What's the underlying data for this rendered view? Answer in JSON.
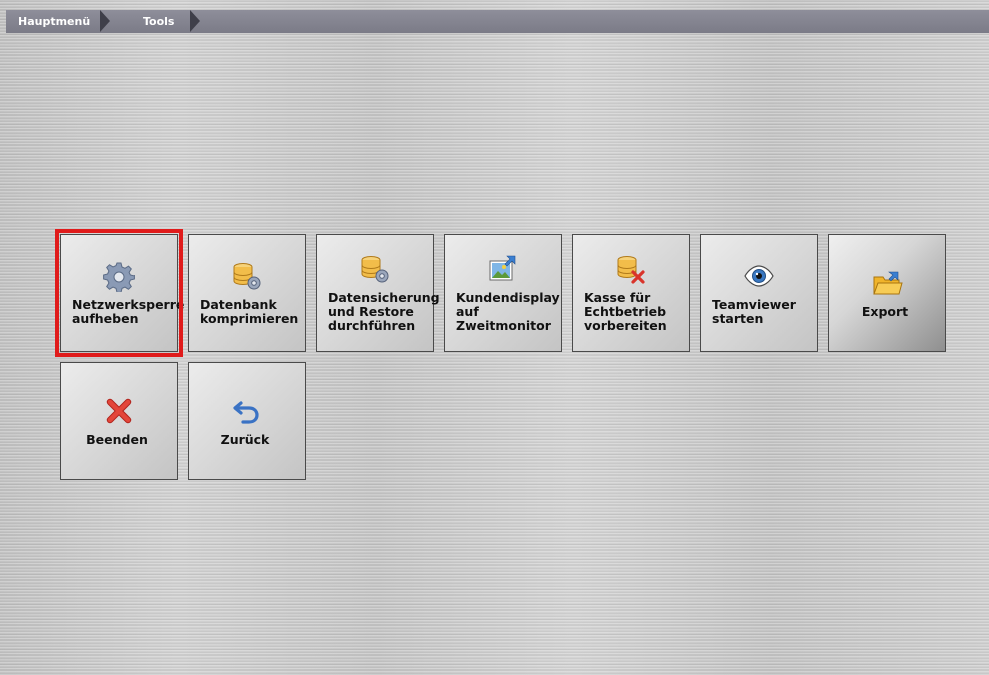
{
  "breadcrumb": {
    "items": [
      {
        "label": "Hauptmenü"
      },
      {
        "label": "Tools"
      }
    ]
  },
  "tiles": [
    {
      "label": "Netzwerksperre\naufheben",
      "icon": "gear-icon",
      "selected": true
    },
    {
      "label": "Datenbank\nkomprimieren",
      "icon": "database-gear-icon"
    },
    {
      "label": "Datensicherung\nund Restore\ndurchführen",
      "icon": "database-gear-icon"
    },
    {
      "label": "Kundendisplay\nauf\nZweitmonitor",
      "icon": "picture-export-icon"
    },
    {
      "label": "Kasse für\nEchtbetrieb\nvorbereiten",
      "icon": "database-delete-icon"
    },
    {
      "label": "Teamviewer\nstarten",
      "icon": "eye-icon"
    },
    {
      "label": "Export",
      "icon": "folder-export-icon"
    },
    {
      "label": "Beenden",
      "icon": "close-icon"
    },
    {
      "label": "Zurück",
      "icon": "undo-icon"
    }
  ],
  "colors": {
    "selection": "#e01b1b",
    "breadcrumb_bg": "#84848f"
  }
}
